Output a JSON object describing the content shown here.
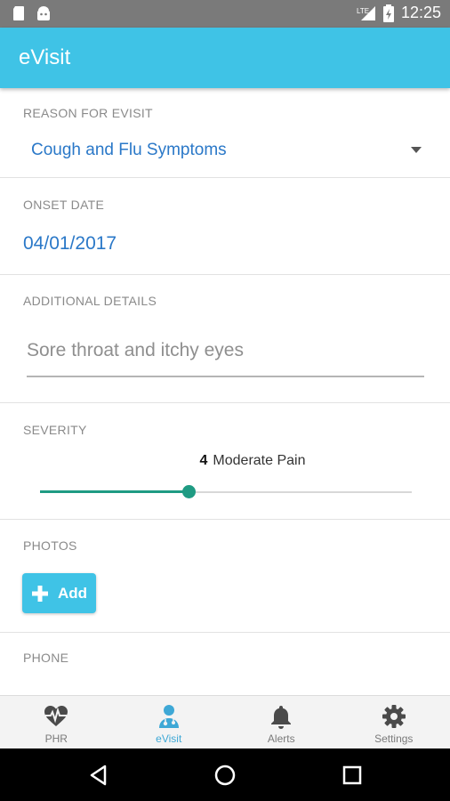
{
  "status_bar": {
    "time": "12:25",
    "network": "LTE",
    "left_icons": [
      "sd-card-icon",
      "android-icon"
    ],
    "right_icons": [
      "signal-icon",
      "battery-charging-icon"
    ]
  },
  "app_bar": {
    "title": "eVisit",
    "color": "#3fc3e6"
  },
  "reason": {
    "label": "REASON FOR EVISIT",
    "value": "Cough and Flu Symptoms"
  },
  "onset": {
    "label": "ONSET DATE",
    "value": "04/01/2017"
  },
  "details": {
    "label": "ADDITIONAL DETAILS",
    "value": "Sore throat and itchy eyes"
  },
  "severity": {
    "label": "SEVERITY",
    "value": "4",
    "description": "Moderate Pain",
    "level": 0.4,
    "color": "#1f9b83"
  },
  "photos": {
    "label": "PHOTOS",
    "add_label": "Add"
  },
  "phone": {
    "label": "PHONE"
  },
  "bottom_nav": [
    {
      "label": "PHR",
      "icon": "heart-pulse-icon",
      "active": false
    },
    {
      "label": "eVisit",
      "icon": "doctor-icon",
      "active": true
    },
    {
      "label": "Alerts",
      "icon": "bell-icon",
      "active": false
    },
    {
      "label": "Settings",
      "icon": "gear-icon",
      "active": false
    }
  ],
  "system_nav": [
    "back-icon",
    "home-icon",
    "recents-icon"
  ]
}
